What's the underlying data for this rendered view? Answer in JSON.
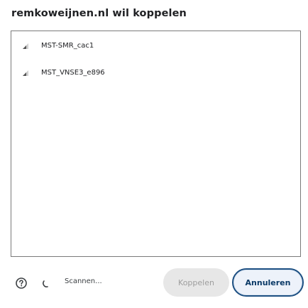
{
  "dialog": {
    "title": "remkoweijnen.nl wil koppelen"
  },
  "devices": [
    {
      "name": "MST-SMR_cac1",
      "icon": "signal-strength-icon"
    },
    {
      "name": "MST_VNSE3_e896",
      "icon": "signal-strength-icon"
    }
  ],
  "footer": {
    "help_icon": "help-icon",
    "spinner_icon": "loading-spinner-icon",
    "scan_status": "Scannen...",
    "connect_label": "Koppelen",
    "cancel_label": "Annuleren"
  },
  "colors": {
    "accent": "#1c4f82",
    "disabled_bg": "#e7e7e7",
    "disabled_text": "#9e9e9e",
    "border": "#7a7a7a"
  }
}
